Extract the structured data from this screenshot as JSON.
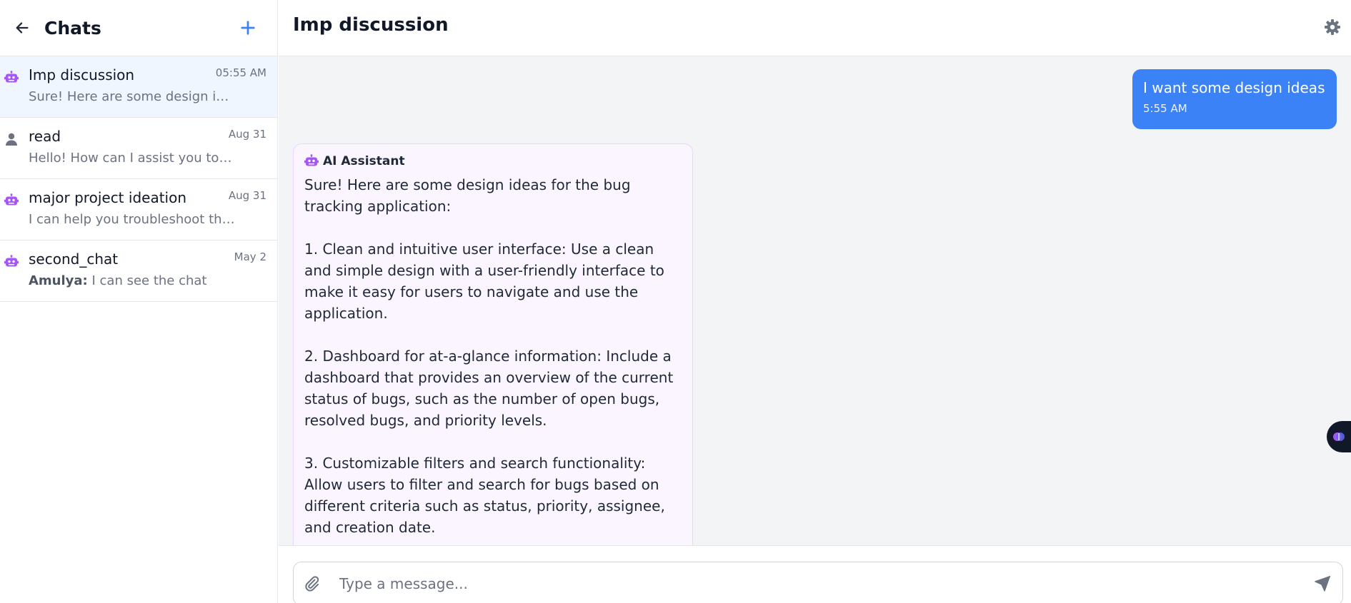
{
  "sidebar": {
    "title": "Chats",
    "chats": [
      {
        "title": "Imp discussion",
        "time": "05:55 AM",
        "preview": "Sure! Here are some design ideas for the bug tracking application:",
        "author": "",
        "type": "bot",
        "active": true
      },
      {
        "title": "read",
        "time": "Aug 31",
        "preview": "Hello! How can I assist you today?",
        "author": "",
        "type": "user",
        "active": false
      },
      {
        "title": "major project ideation",
        "time": "Aug 31",
        "preview": "I can help you troubleshoot the issue",
        "author": "",
        "type": "bot",
        "active": false
      },
      {
        "title": "second_chat",
        "time": "May 2",
        "preview": "I can see the chat",
        "author": "Amulya:",
        "type": "bot",
        "active": false
      }
    ]
  },
  "main": {
    "title": "Imp discussion",
    "messages": {
      "user": {
        "text": "I want some design ideas",
        "time": "5:55 AM"
      },
      "assistant": {
        "name": "AI Assistant",
        "text": "Sure! Here are some design ideas for the bug tracking application:\n\n1. Clean and intuitive user interface: Use a clean and simple design with a user-friendly interface to make it easy for users to navigate and use the application.\n\n2. Dashboard for at-a-glance information: Include a dashboard that provides an overview of the current status of bugs, such as the number of open bugs, resolved bugs, and priority levels.\n\n3. Customizable filters and search functionality: Allow users to filter and search for bugs based on different criteria such as status, priority, assignee, and creation date."
      }
    },
    "composer": {
      "placeholder": "Type a message..."
    }
  },
  "icons": {
    "back": "arrow-left-icon",
    "new_chat": "plus-icon",
    "settings": "gear-icon",
    "bot": "robot-icon",
    "user": "person-icon",
    "attach": "paperclip-icon",
    "send": "send-icon",
    "scroll_down": "chevron-down-icon"
  },
  "colors": {
    "accent": "#3b82f6",
    "bot_icon": "#a855f7",
    "user_icon": "#6b7280",
    "active_row": "#eff6ff",
    "ai_bubble": "#faf5ff"
  }
}
